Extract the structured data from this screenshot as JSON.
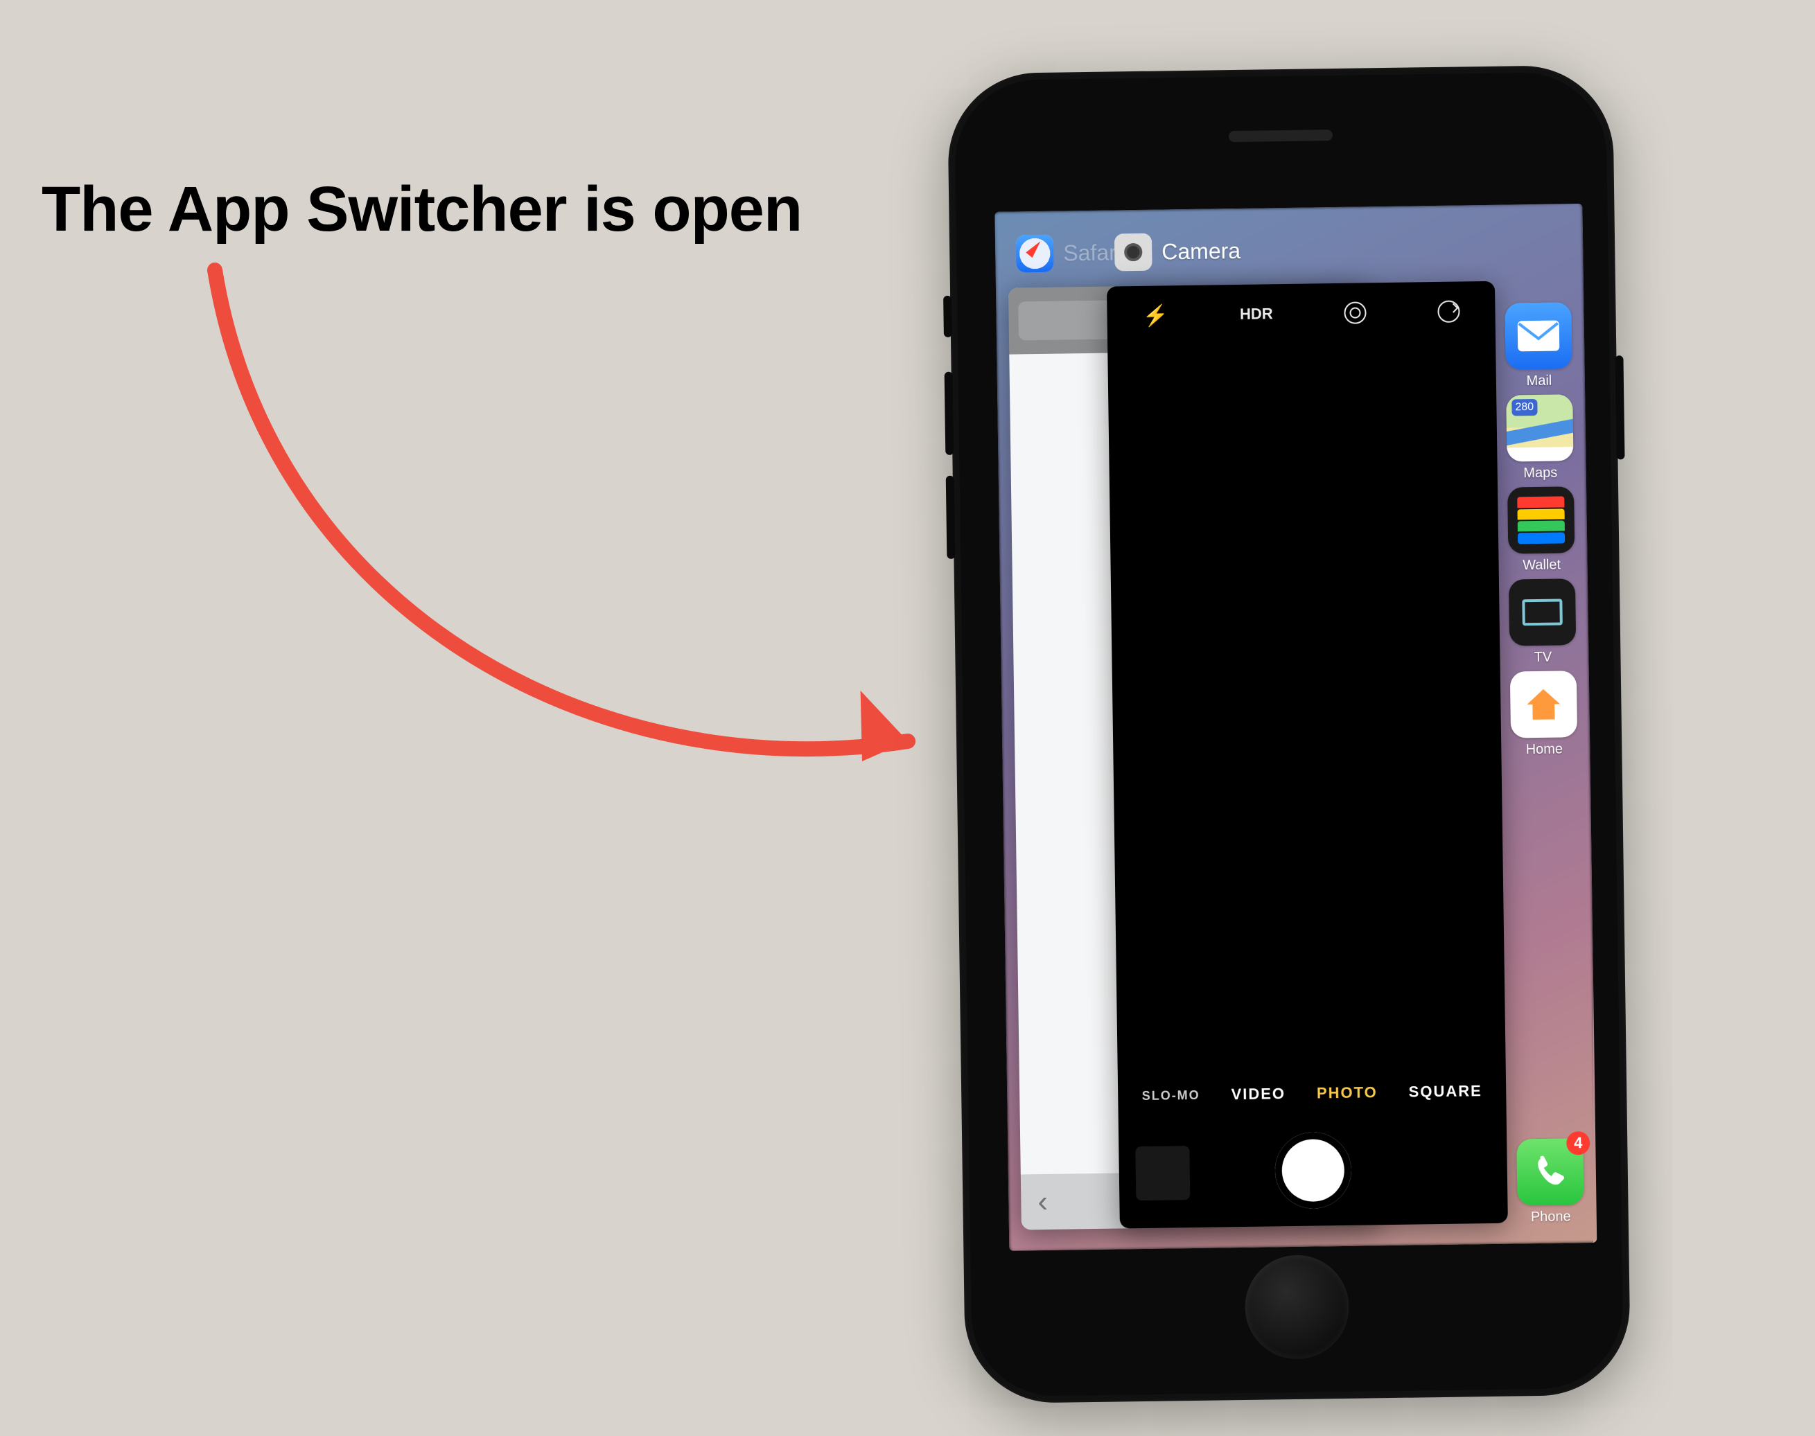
{
  "annotation": {
    "text": "The App Switcher is open",
    "arrow_color": "#ee4d3e"
  },
  "switcher": {
    "cards": {
      "safari": {
        "label": "Safari",
        "back_glyph": "‹"
      },
      "camera": {
        "label": "Camera",
        "top": {
          "flash": "⚡",
          "hdr": "HDR"
        },
        "modes": {
          "slomo": "SLO-MO",
          "video": "VIDEO",
          "photo": "PHOTO",
          "square": "SQUARE",
          "active": "photo"
        }
      }
    }
  },
  "home_icons": {
    "mail": {
      "label": "Mail",
      "glyph": "✉"
    },
    "maps": {
      "label": "Maps",
      "sign": "280"
    },
    "wallet": {
      "label": "Wallet"
    },
    "tv": {
      "label": "TV"
    },
    "home": {
      "label": "Home"
    }
  },
  "dock": {
    "phone": {
      "label": "Phone",
      "glyph": "✆",
      "badge": "4"
    }
  }
}
